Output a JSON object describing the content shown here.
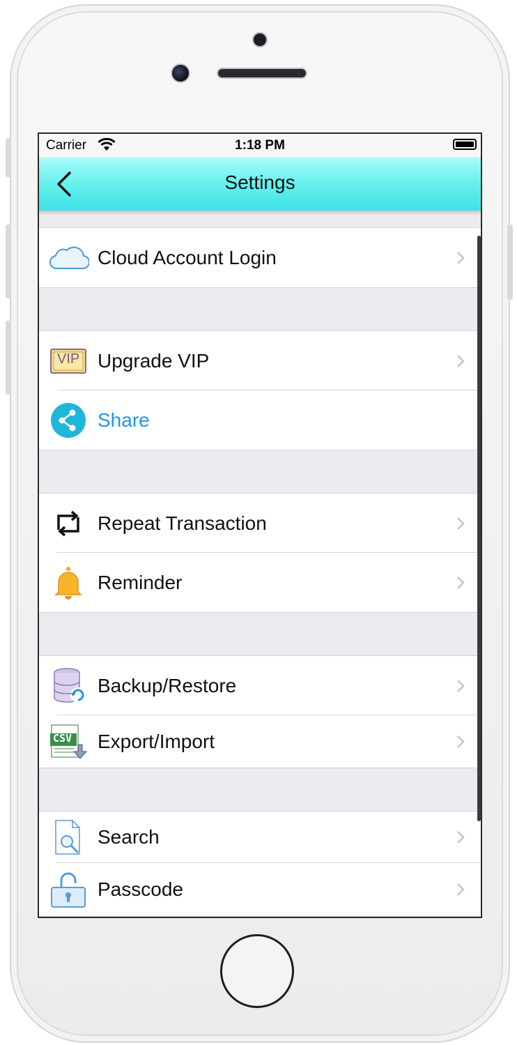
{
  "status_bar": {
    "carrier": "Carrier",
    "time": "1:18 PM"
  },
  "navbar": {
    "title": "Settings"
  },
  "colors": {
    "navbar_top": "#a8fbf8",
    "navbar_bottom": "#3ee3e6",
    "share_blue": "#1e96e8",
    "background": "#ececf0"
  },
  "groups": [
    {
      "items": [
        {
          "label": "Cloud Account Login",
          "icon": "cloud-icon",
          "chevron": true
        }
      ]
    },
    {
      "items": [
        {
          "label": "Upgrade VIP",
          "icon": "vip-icon",
          "chevron": true
        },
        {
          "label": "Share",
          "icon": "share-icon",
          "chevron": false
        }
      ]
    },
    {
      "items": [
        {
          "label": "Repeat Transaction",
          "icon": "repeat-icon",
          "chevron": true
        },
        {
          "label": "Reminder",
          "icon": "bell-icon",
          "chevron": true
        }
      ]
    },
    {
      "items": [
        {
          "label": "Backup/Restore",
          "icon": "database-icon",
          "chevron": true
        },
        {
          "label": "Export/Import",
          "icon": "csv-icon",
          "chevron": true,
          "icon_text": "CSV"
        }
      ]
    },
    {
      "items": [
        {
          "label": "Search",
          "icon": "search-document-icon",
          "chevron": true
        },
        {
          "label": "Passcode",
          "icon": "padlock-icon",
          "chevron": true
        }
      ]
    }
  ],
  "vip_icon_text": "VIP"
}
